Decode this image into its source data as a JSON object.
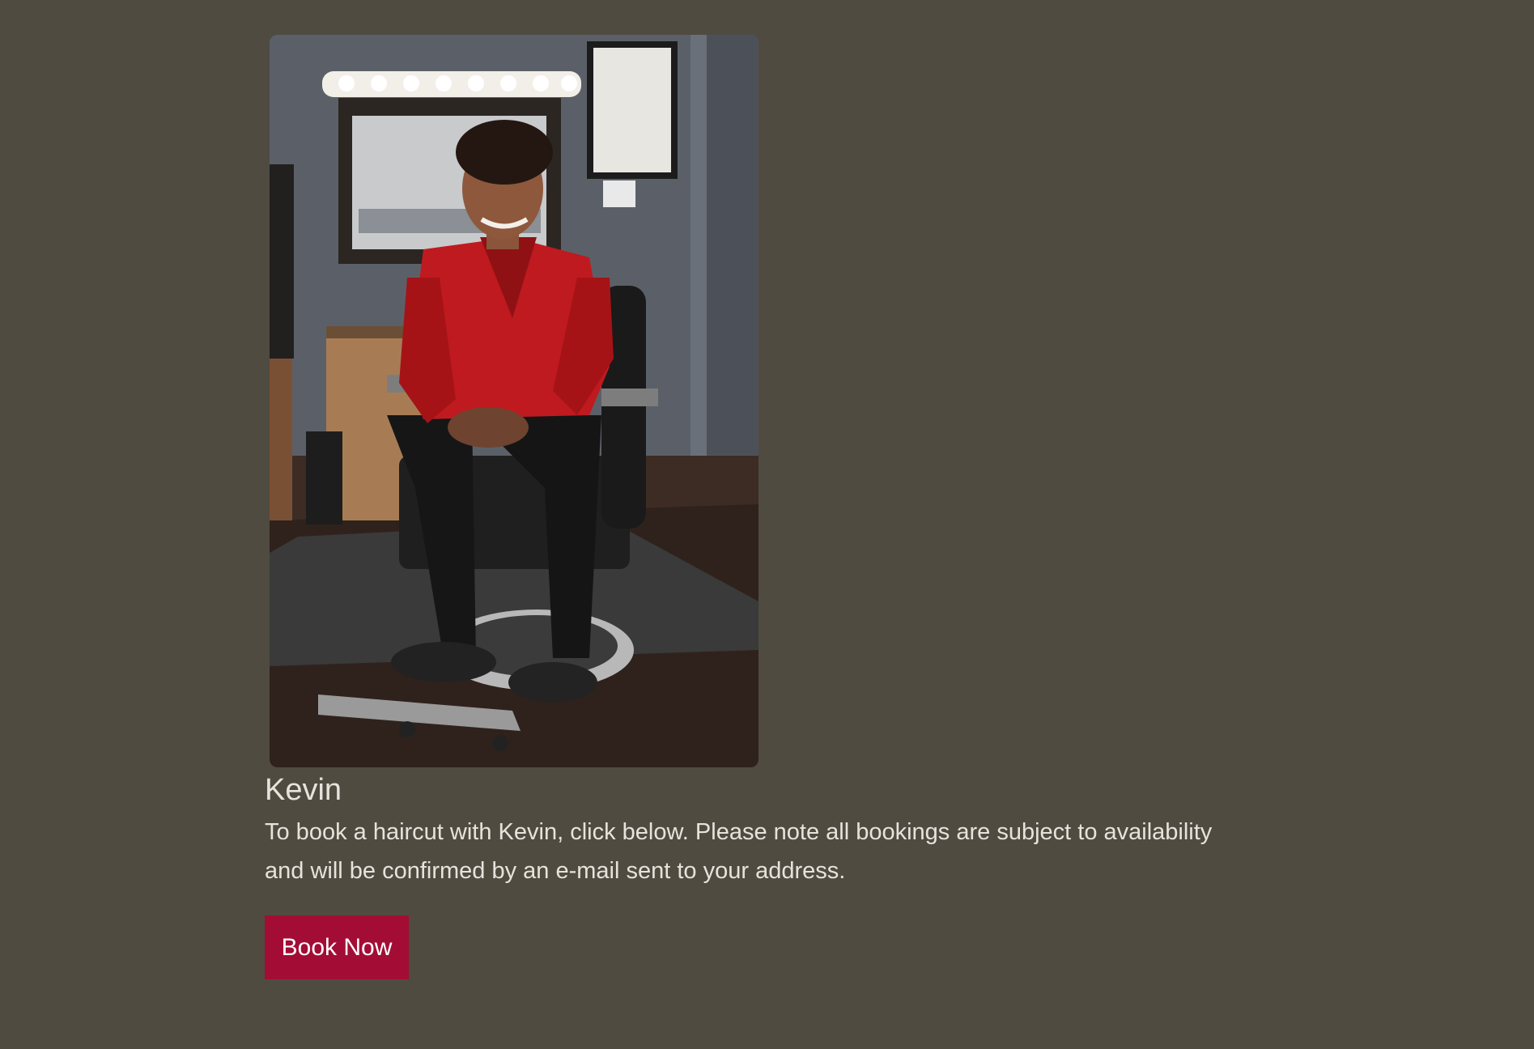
{
  "barber": {
    "photo_alt": "Kevin",
    "name": "Kevin",
    "description": "To book a haircut with Kevin, click below. Please note all bookings are subject to availability and will be confirmed by an e-mail sent to your address.",
    "book_label": "Book Now"
  },
  "colors": {
    "background": "#4f4b41",
    "button": "#a30d35",
    "text": "#e6e3dd"
  }
}
